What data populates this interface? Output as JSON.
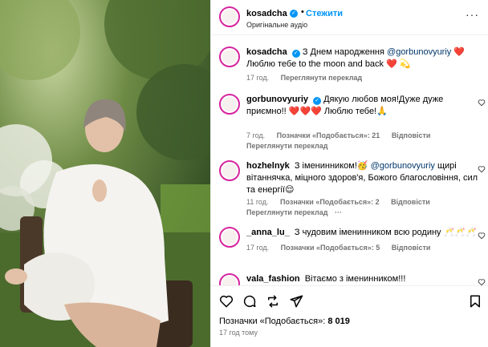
{
  "post": {
    "author": "kosadcha",
    "follow_label": "Стежити",
    "audio": "Оригінальне аудіо",
    "likes_label": "Позначки «Подобається»:",
    "likes_count": "8 019",
    "posted_ago": "17 год тому"
  },
  "comments": [
    {
      "user": "kosadcha",
      "text_before": "З Днем народження",
      "mention": "@gorbunovyuriy",
      "text_after": "❤️ Люблю тебе to the moon and back ❤️ 💫",
      "time": "17 год.",
      "likes": "",
      "reply": "",
      "translate": "Переглянути переклад"
    },
    {
      "user": "gorbunovyuriy",
      "text_before": "Дякую любов моя!Дуже дуже приємно!! ❤️❤️❤️ Люблю тебе!🙏",
      "mention": "",
      "text_after": "",
      "time": "7 год.",
      "likes": "Позначки «Подобається»: 21",
      "reply": "Відповісти",
      "translate": "Переглянути переклад"
    },
    {
      "user": "hozhelnyk",
      "text_before": "З іменинником!🥳",
      "mention": "@gorbunovyuriy",
      "text_after": "щирі вітаннячка, міцного здоров'я, Божого благословіння, сил та енергії😌",
      "time": "11 год.",
      "likes": "Позначки «Подобається»: 2",
      "reply": "Відповісти",
      "translate": "Переглянути переклад",
      "extra": "···"
    },
    {
      "user": "_anna_lu_",
      "text_before": "З чудовим іменинником всю родину 🥂🥂🥂",
      "mention": "",
      "text_after": "",
      "time": "17 год.",
      "likes": "Позначки «Подобається»: 5",
      "reply": "Відповісти",
      "translate": ""
    },
    {
      "user": "vala_fashion",
      "text_before": "Вітаємо з іменинником!!!",
      "mention": "",
      "text_after": "",
      "time": "",
      "likes": "",
      "reply": "",
      "translate": ""
    }
  ],
  "icons": {
    "like": "heart-icon",
    "comment": "comment-icon",
    "share": "repost-icon",
    "send": "send-icon",
    "save": "bookmark-icon"
  }
}
